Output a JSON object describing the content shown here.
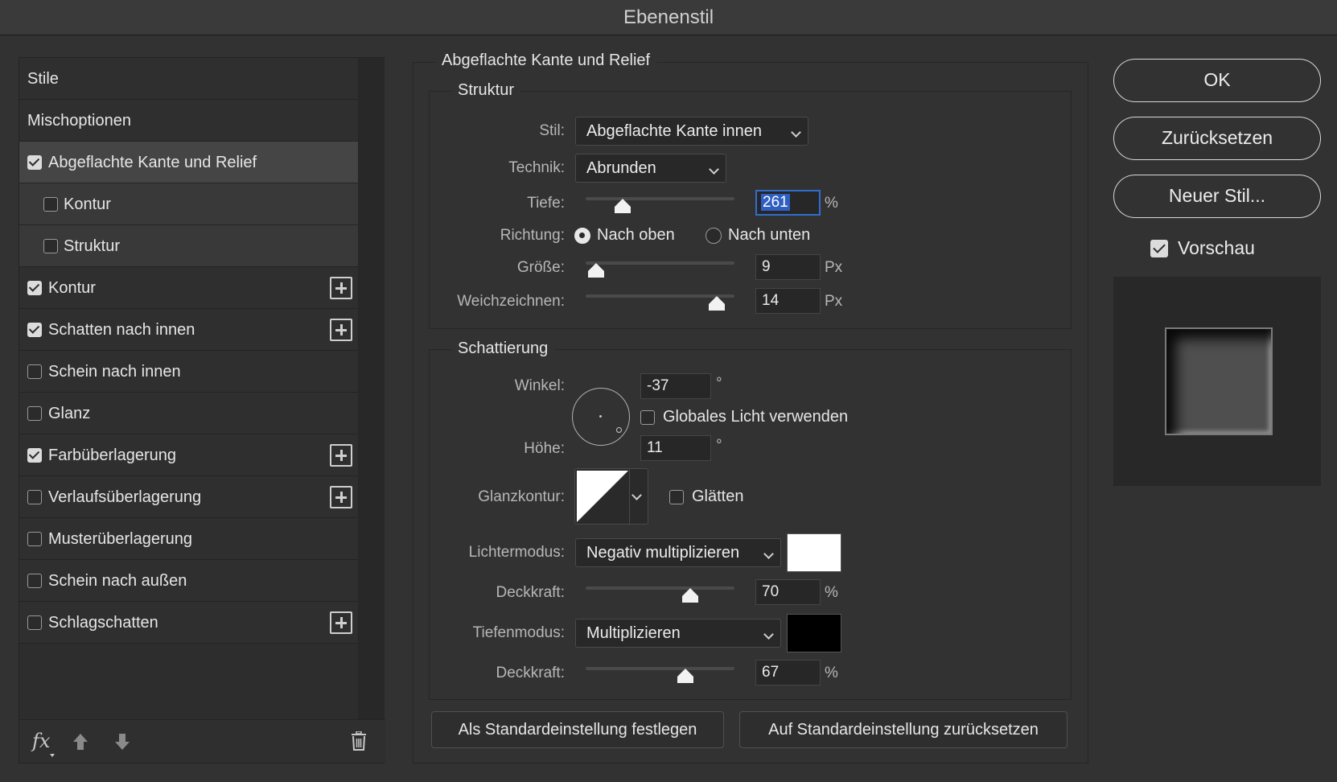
{
  "window": {
    "title": "Ebenenstil"
  },
  "left_panel": {
    "items": [
      {
        "label": "Stile",
        "checkbox": null,
        "add": false,
        "sub": false,
        "active": false
      },
      {
        "label": "Mischoptionen",
        "checkbox": null,
        "add": false,
        "sub": false,
        "active": false
      },
      {
        "label": "Abgeflachte Kante und Relief",
        "checkbox": true,
        "add": false,
        "sub": false,
        "active": true
      },
      {
        "label": "Kontur",
        "checkbox": false,
        "add": false,
        "sub": true,
        "active": false
      },
      {
        "label": "Struktur",
        "checkbox": false,
        "add": false,
        "sub": true,
        "active": false
      },
      {
        "label": "Kontur",
        "checkbox": true,
        "add": true,
        "sub": false,
        "active": false
      },
      {
        "label": "Schatten nach innen",
        "checkbox": true,
        "add": true,
        "sub": false,
        "active": false
      },
      {
        "label": "Schein nach innen",
        "checkbox": false,
        "add": false,
        "sub": false,
        "active": false
      },
      {
        "label": "Glanz",
        "checkbox": false,
        "add": false,
        "sub": false,
        "active": false
      },
      {
        "label": "Farbüberlagerung",
        "checkbox": true,
        "add": true,
        "sub": false,
        "active": false
      },
      {
        "label": "Verlaufsüberlagerung",
        "checkbox": false,
        "add": true,
        "sub": false,
        "active": false
      },
      {
        "label": "Musterüberlagerung",
        "checkbox": false,
        "add": false,
        "sub": false,
        "active": false
      },
      {
        "label": "Schein nach außen",
        "checkbox": false,
        "add": false,
        "sub": false,
        "active": false
      },
      {
        "label": "Schlagschatten",
        "checkbox": false,
        "add": true,
        "sub": false,
        "active": false
      }
    ],
    "footer": {
      "fx_label": "fx"
    }
  },
  "main": {
    "section_title": "Abgeflachte Kante und Relief",
    "structure": {
      "title": "Struktur",
      "stil_label": "Stil:",
      "stil_value": "Abgeflachte Kante innen",
      "technik_label": "Technik:",
      "technik_value": "Abrunden",
      "tiefe_label": "Tiefe:",
      "tiefe_value": "261",
      "tiefe_unit": "%",
      "tiefe_slider_pct": 0.25,
      "richtung_label": "Richtung:",
      "richtung_up": "Nach oben",
      "richtung_down": "Nach unten",
      "richtung_selected": "up",
      "groesse_label": "Größe:",
      "groesse_value": "9",
      "groesse_unit": "Px",
      "groesse_slider_pct": 0.07,
      "weich_label": "Weichzeichnen:",
      "weich_value": "14",
      "weich_unit": "Px",
      "weich_slider_pct": 0.88
    },
    "shading": {
      "title": "Schattierung",
      "winkel_label": "Winkel:",
      "winkel_value": "-37",
      "winkel_unit": "°",
      "global_light_label": "Globales Licht verwenden",
      "global_light_checked": false,
      "hoehe_label": "Höhe:",
      "hoehe_value": "11",
      "hoehe_unit": "°",
      "glanzkontur_label": "Glanzkontur:",
      "glaetten_label": "Glätten",
      "glaetten_checked": false,
      "lichtermodus_label": "Lichtermodus:",
      "lichtermodus_value": "Negativ multiplizieren",
      "lichter_color": "#ffffff",
      "deckkraft1_label": "Deckkraft:",
      "deckkraft1_value": "70",
      "deckkraft1_unit": "%",
      "deckkraft1_slider_pct": 0.7,
      "tiefenmodus_label": "Tiefenmodus:",
      "tiefenmodus_value": "Multiplizieren",
      "tiefen_color": "#000000",
      "deckkraft2_label": "Deckkraft:",
      "deckkraft2_value": "67",
      "deckkraft2_unit": "%",
      "deckkraft2_slider_pct": 0.67
    },
    "buttons": {
      "set_default": "Als Standardeinstellung festlegen",
      "reset_default": "Auf Standardeinstellung zurücksetzen"
    }
  },
  "right_panel": {
    "ok": "OK",
    "reset": "Zurücksetzen",
    "new_style": "Neuer Stil...",
    "preview_label": "Vorschau",
    "preview_checked": true
  }
}
